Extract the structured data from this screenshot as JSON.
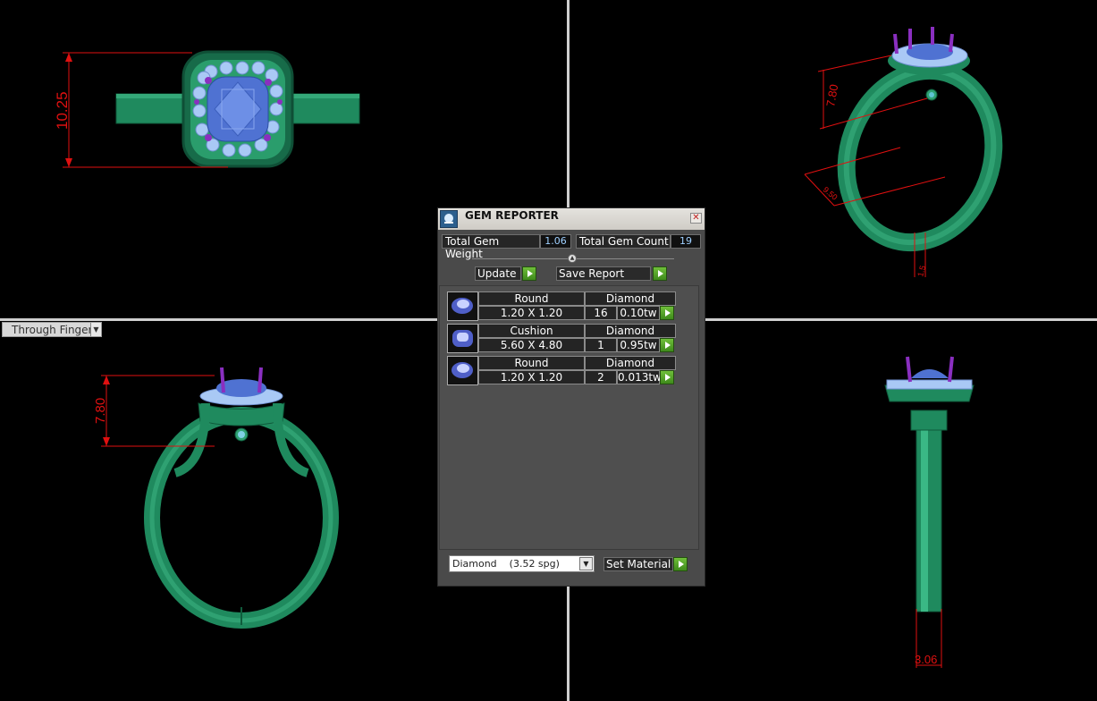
{
  "viewports": {
    "top_view_dimension": "10.25",
    "perspective_dimension": "7.80",
    "front_view_dimension": "7.80",
    "side_view_dimension": "3.06",
    "perspective_small_dim_1": "9.50",
    "perspective_small_dim_2": "1.5",
    "view_mode_dropdown": "Through Finger"
  },
  "panel": {
    "title": "GEM REPORTER",
    "total_gem_weight_label": "Total Gem Weight",
    "total_gem_weight_value": "1.06",
    "total_gem_count_label": "Total Gem Count",
    "total_gem_count_value": "19",
    "update_label": "Update",
    "save_report_label": "Save Report",
    "gems": [
      {
        "shape": "Round",
        "size": "1.20 X 1.20",
        "material": "Diamond",
        "count": "16",
        "weight": "0.10tw"
      },
      {
        "shape": "Cushion",
        "size": "5.60 X 4.80",
        "material": "Diamond",
        "count": "1",
        "weight": "0.95tw"
      },
      {
        "shape": "Round",
        "size": "1.20 X 1.20",
        "material": "Diamond",
        "count": "2",
        "weight": "0.013tw"
      }
    ],
    "material_select_value": "Diamond    (3.52 spg)",
    "set_material_label": "Set Material"
  },
  "colors": {
    "ring_metal": "#1f8a5e",
    "gem_blue": "#5b7fd6",
    "prong_purple": "#8a2fc0",
    "dimension_red": "#e01010",
    "panel_bg": "#4a4a4a",
    "go_button_green": "#4fa527"
  }
}
